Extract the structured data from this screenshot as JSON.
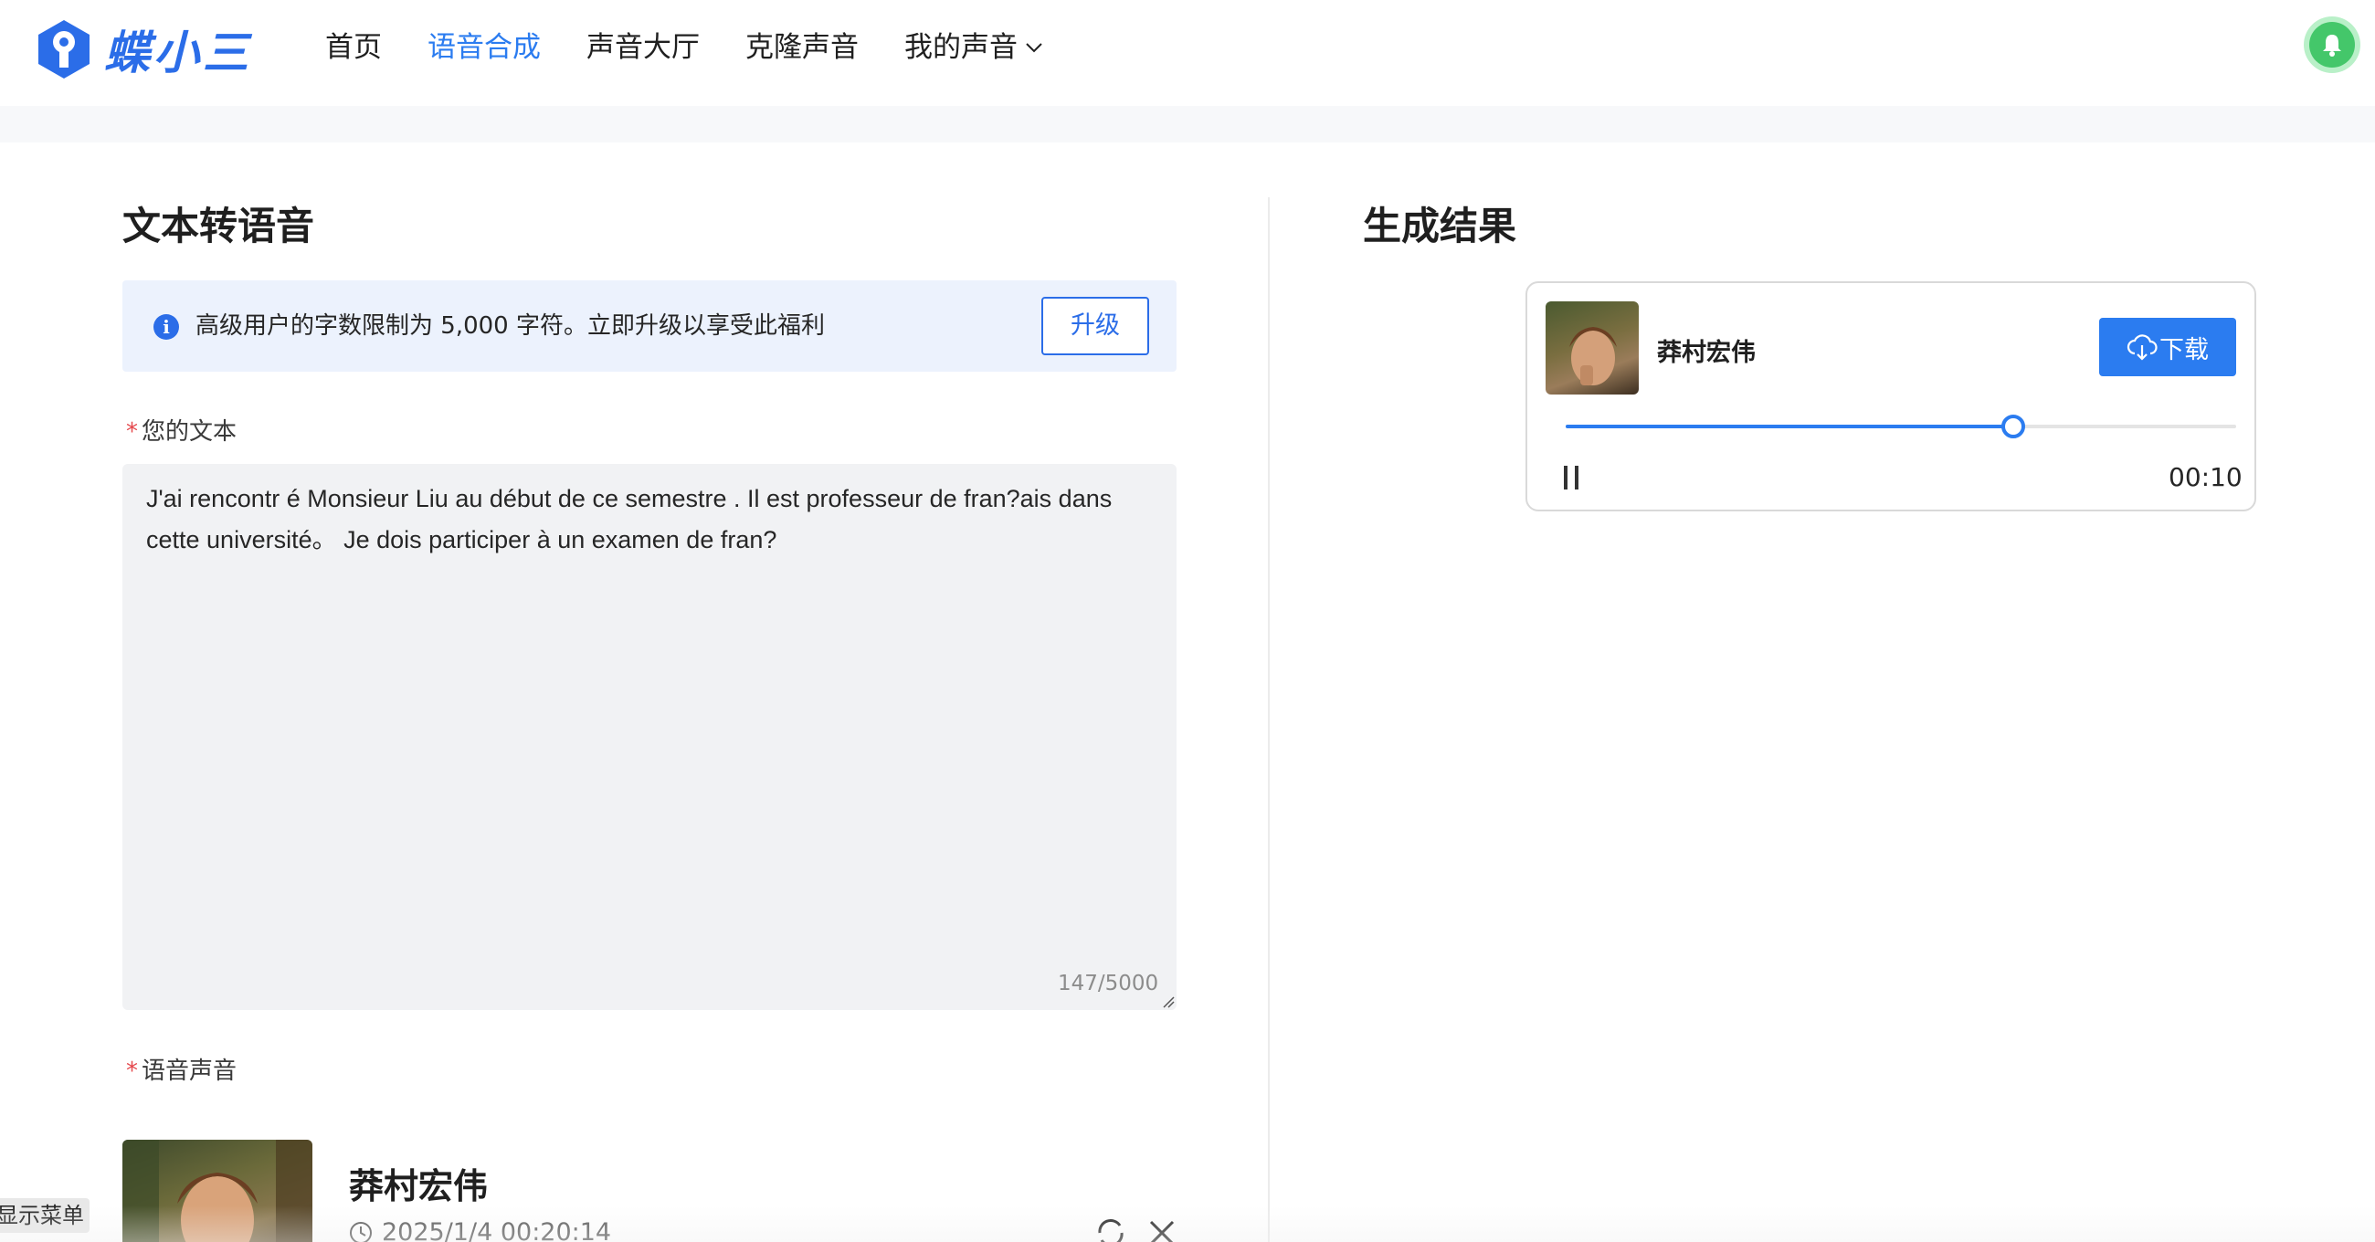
{
  "header": {
    "logo_text": "蝶小三",
    "nav": [
      {
        "label": "首页",
        "active": false
      },
      {
        "label": "语音合成",
        "active": true
      },
      {
        "label": "声音大厅",
        "active": false
      },
      {
        "label": "克隆声音",
        "active": false
      },
      {
        "label": "我的声音",
        "active": false,
        "dropdown": true
      }
    ],
    "bell_icon": "bell-icon"
  },
  "left": {
    "title": "文本转语音",
    "notice": {
      "text": "高级用户的字数限制为 5,000 字符。立即升级以享受此福利",
      "upgrade_label": "升级"
    },
    "text_field": {
      "label": "您的文本",
      "value": "J'ai rencontr é Monsieur Liu au début de ce semestre . Il est professeur de fran?ais dans cette université。 Je dois participer à un examen de fran?",
      "char_count": "147/5000"
    },
    "voice_field": {
      "label": "语音声音",
      "voice_name": "莽村宏伟",
      "voice_date": "2025/1/4 00:20:14"
    },
    "show_menu_label": "显示菜单"
  },
  "right": {
    "title": "生成结果",
    "result": {
      "voice_name": "莽村宏伟",
      "download_label": "下载",
      "progress_fraction": 0.667,
      "time": "00:10"
    }
  },
  "colors": {
    "accent": "#2b7cf0",
    "notice_bg": "#ecf2fd",
    "required": "#e5484d"
  }
}
